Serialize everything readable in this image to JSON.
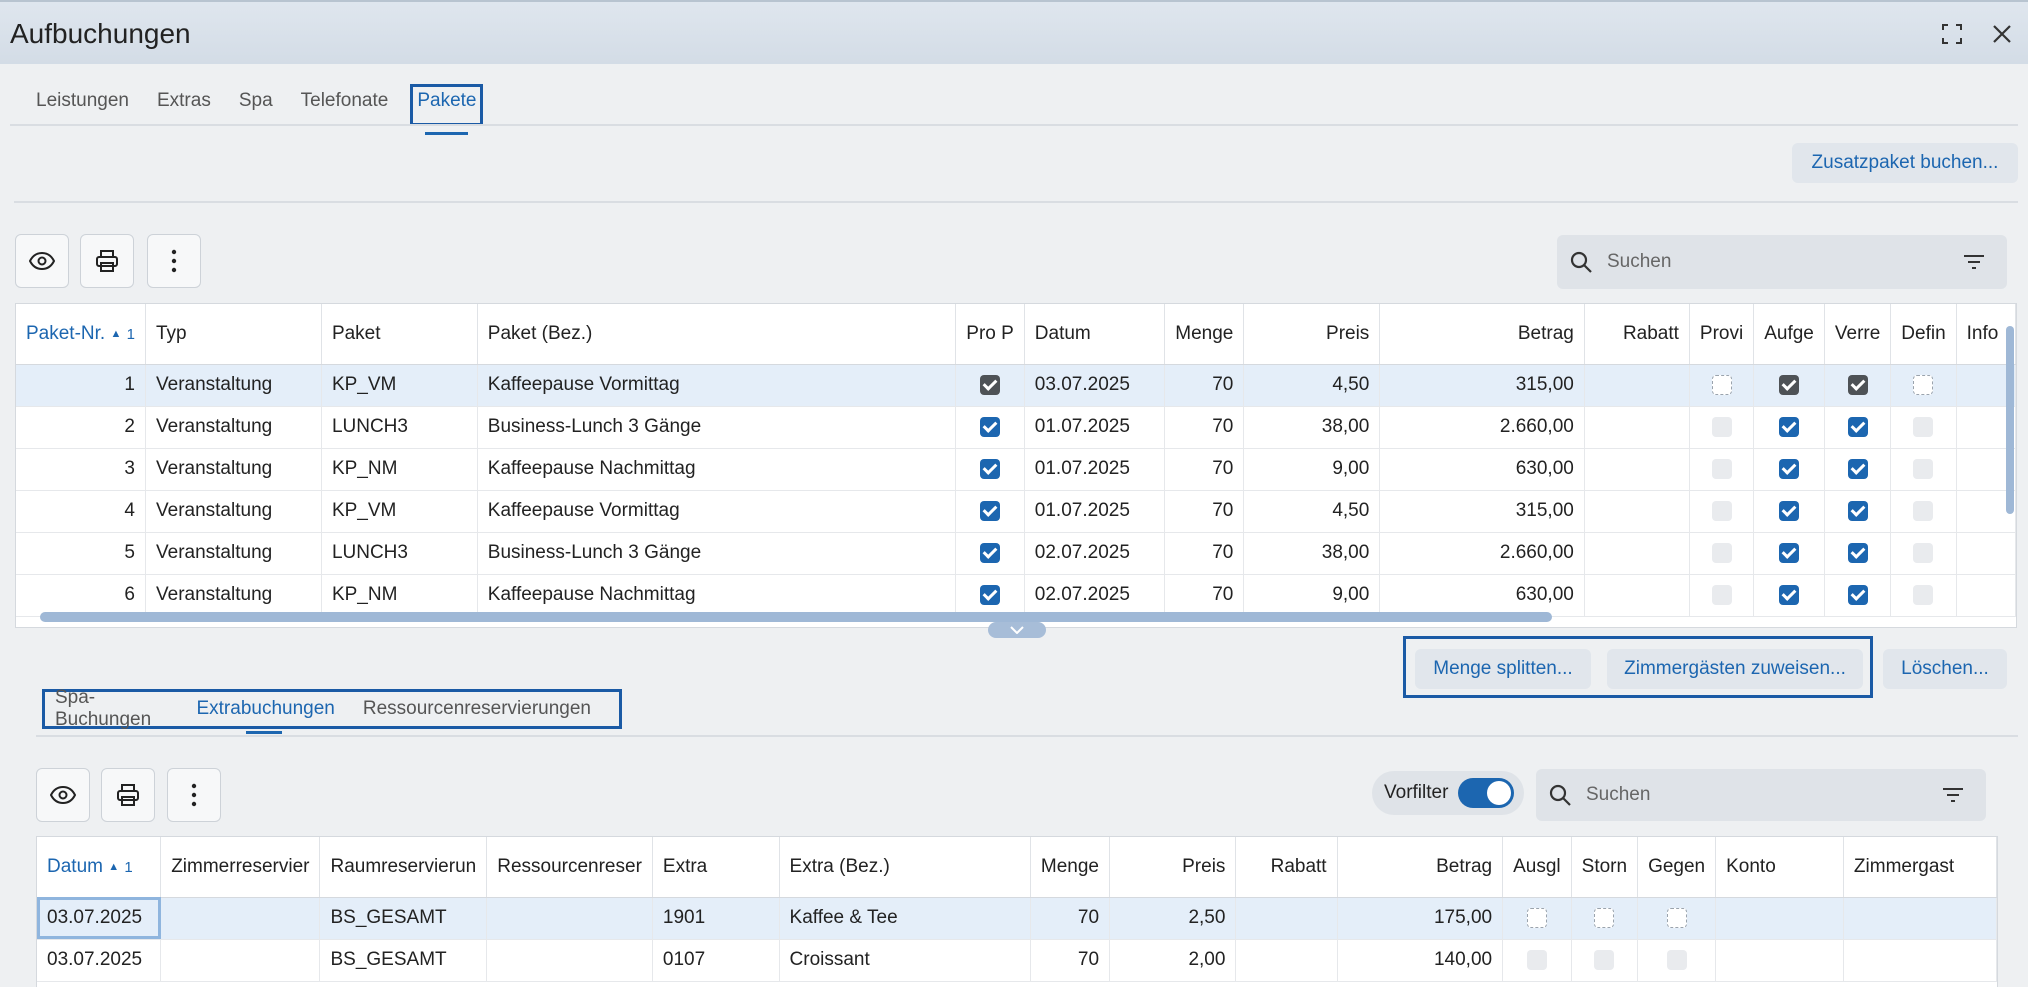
{
  "window": {
    "title": "Aufbuchungen"
  },
  "tabs": [
    "Leistungen",
    "Extras",
    "Spa",
    "Telefonate",
    "Pakete"
  ],
  "active_tab": "Pakete",
  "actions": {
    "zusatzpaket": "Zusatzpaket buchen...",
    "menge_splitten": "Menge splitten...",
    "zimmergaeste": "Zimmergästen zuweisen...",
    "loeschen": "Löschen..."
  },
  "top_search": {
    "placeholder": "Suchen"
  },
  "top_table": {
    "headers": [
      "Paket-Nr.",
      "Typ",
      "Paket",
      "Paket (Bez.)",
      "Pro P",
      "Datum",
      "Menge",
      "Preis",
      "Betrag",
      "Rabatt",
      "Provi",
      "Aufge",
      "Verre",
      "Defin",
      "Info"
    ],
    "sort_index": "1",
    "rows": [
      {
        "nr": "1",
        "typ": "Veranstaltung",
        "paket": "KP_VM",
        "bez": "Kaffeepause Vormittag",
        "datum": "03.07.2025",
        "menge": "70",
        "preis": "4,50",
        "betrag": "315,00"
      },
      {
        "nr": "2",
        "typ": "Veranstaltung",
        "paket": "LUNCH3",
        "bez": "Business-Lunch 3 Gänge",
        "datum": "01.07.2025",
        "menge": "70",
        "preis": "38,00",
        "betrag": "2.660,00"
      },
      {
        "nr": "3",
        "typ": "Veranstaltung",
        "paket": "KP_NM",
        "bez": "Kaffeepause Nachmittag",
        "datum": "01.07.2025",
        "menge": "70",
        "preis": "9,00",
        "betrag": "630,00"
      },
      {
        "nr": "4",
        "typ": "Veranstaltung",
        "paket": "KP_VM",
        "bez": "Kaffeepause Vormittag",
        "datum": "01.07.2025",
        "menge": "70",
        "preis": "4,50",
        "betrag": "315,00"
      },
      {
        "nr": "5",
        "typ": "Veranstaltung",
        "paket": "LUNCH3",
        "bez": "Business-Lunch 3 Gänge",
        "datum": "02.07.2025",
        "menge": "70",
        "preis": "38,00",
        "betrag": "2.660,00"
      },
      {
        "nr": "6",
        "typ": "Veranstaltung",
        "paket": "KP_NM",
        "bez": "Kaffeepause Nachmittag",
        "datum": "02.07.2025",
        "menge": "70",
        "preis": "9,00",
        "betrag": "630,00"
      }
    ]
  },
  "subtabs": [
    "Spa-Buchungen",
    "Extrabuchungen",
    "Ressourcenreservierungen"
  ],
  "active_subtab": "Extrabuchungen",
  "vorfilter": {
    "label": "Vorfilter"
  },
  "bottom_search": {
    "placeholder": "Suchen"
  },
  "bottom_table": {
    "headers": [
      "Datum",
      "Zimmerreservier",
      "Raumreservierun",
      "Ressourcenreser",
      "Extra",
      "Extra (Bez.)",
      "Menge",
      "Preis",
      "Rabatt",
      "Betrag",
      "Ausgl",
      "Storn",
      "Gegen",
      "Konto",
      "Zimmergast"
    ],
    "sort_index": "1",
    "rows": [
      {
        "datum": "03.07.2025",
        "raum": "BS_GESAMT",
        "extra": "1901",
        "bez": "Kaffee & Tee",
        "menge": "70",
        "preis": "2,50",
        "betrag": "175,00"
      },
      {
        "datum": "03.07.2025",
        "raum": "BS_GESAMT",
        "extra": "0107",
        "bez": "Croissant",
        "menge": "70",
        "preis": "2,00",
        "betrag": "140,00"
      }
    ]
  },
  "colors": {
    "accent": "#1c66b0",
    "selection": "#e4eef9",
    "focus_border": "#1a5aa5"
  }
}
